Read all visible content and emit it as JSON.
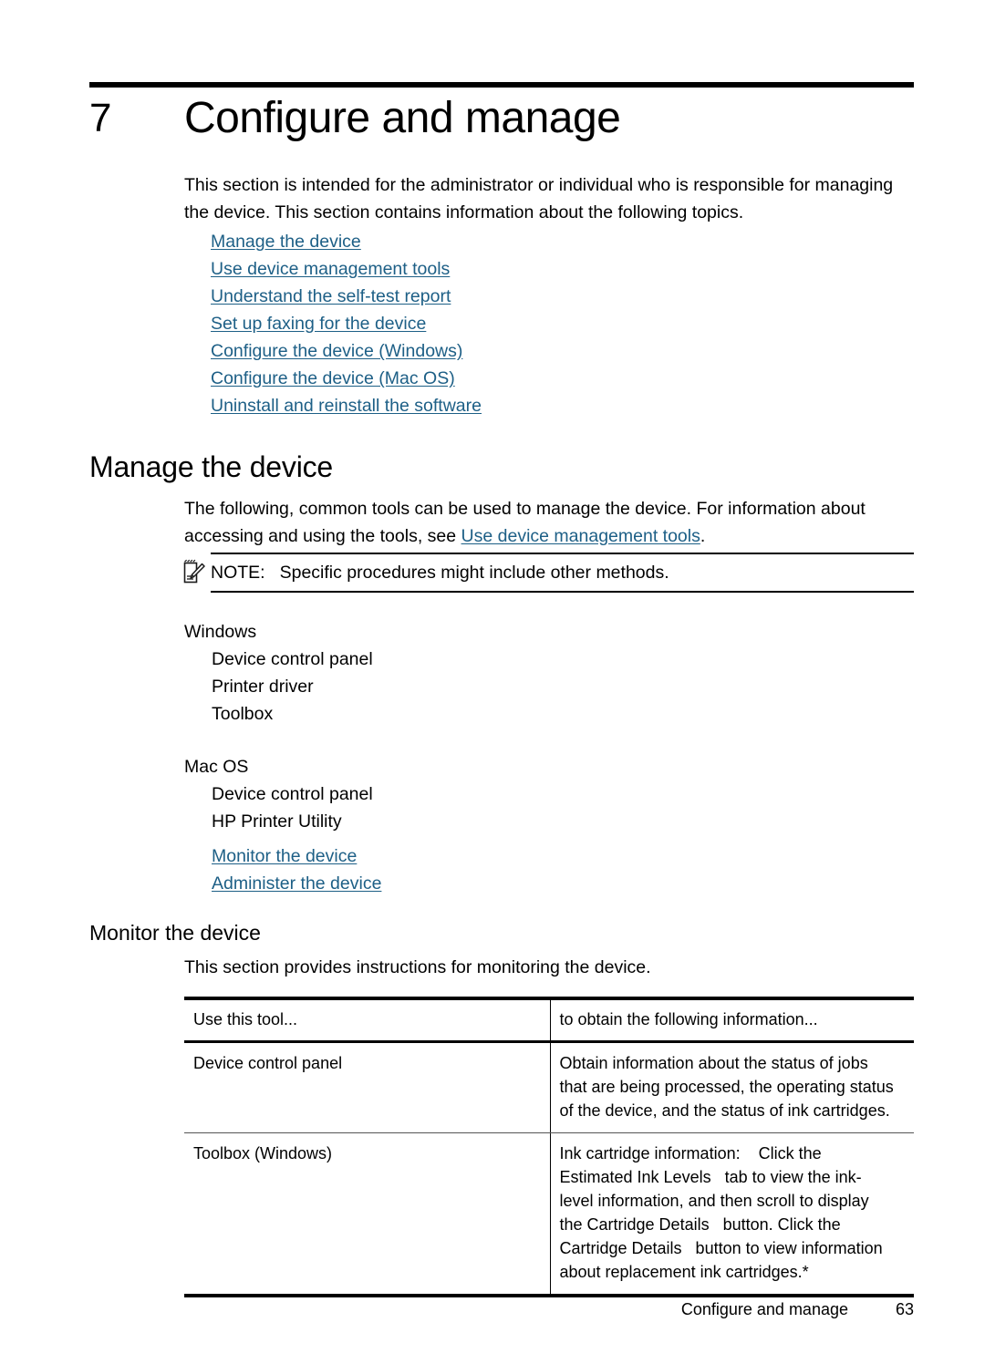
{
  "chapter": {
    "number": "7",
    "title": "Configure and manage"
  },
  "intro": {
    "paragraph": "This section is intended for the administrator or individual who is responsible for managing the device. This section contains information about the following topics."
  },
  "topic_links": [
    {
      "label": "Manage the device"
    },
    {
      "label": "Use device management tools"
    },
    {
      "label": "Understand the self-test report"
    },
    {
      "label": "Set up faxing for the device"
    },
    {
      "label": "Configure the device (Windows)"
    },
    {
      "label": "Configure the device (Mac OS)"
    },
    {
      "label": "Uninstall and reinstall the software"
    }
  ],
  "manage_section": {
    "heading": "Manage the device",
    "paragraph_before_link": "The following, common tools can be used to manage the device. For information about accessing and using the tools, see ",
    "inline_link": "Use device management tools",
    "paragraph_after_link": ".",
    "note": {
      "icon": "note-pad-pencil-icon",
      "label": "NOTE:",
      "text": "Specific procedures might include other methods."
    },
    "platforms": [
      {
        "name": "Windows",
        "items": [
          "Device control panel",
          "Printer driver",
          "Toolbox"
        ],
        "links": []
      },
      {
        "name": "Mac OS",
        "items": [
          "Device control panel",
          "HP Printer Utility"
        ],
        "links": [
          "Monitor the device",
          "Administer the device"
        ]
      }
    ]
  },
  "monitor_section": {
    "heading": "Monitor the device",
    "paragraph": "This section provides instructions for monitoring the device.",
    "table": {
      "headers": [
        "Use this tool...",
        "to obtain the following information..."
      ],
      "rows": [
        {
          "tool": "Device control panel",
          "info_lines": [
            "Obtain information about the status of jobs",
            "that are being processed, the operating status",
            "of the device, and the status of ink cartridges."
          ]
        },
        {
          "tool": "Toolbox (Windows)",
          "info_lines": [
            "Ink cartridge information:    Click the",
            "Estimated Ink Levels   tab to view the ink-",
            "level information, and then scroll to display",
            "the Cartridge Details   button. Click the",
            "Cartridge Details   button to view information",
            "about replacement ink cartridges.*"
          ]
        }
      ]
    }
  },
  "footer": {
    "title": "Configure and manage",
    "page_number": "63"
  },
  "colors": {
    "link": "#1d5f86",
    "text": "#000000",
    "rule": "#000000"
  }
}
